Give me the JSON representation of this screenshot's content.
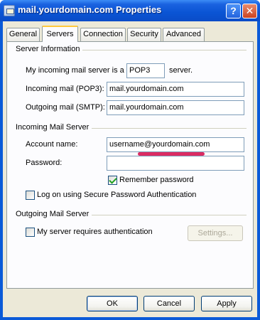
{
  "window": {
    "title": "mail.yourdomain.com Properties",
    "help_glyph": "?",
    "close_glyph": "✕"
  },
  "tabs": [
    {
      "label": "General"
    },
    {
      "label": "Servers"
    },
    {
      "label": "Connection"
    },
    {
      "label": "Security"
    },
    {
      "label": "Advanced"
    }
  ],
  "server_info": {
    "group_label": "Server Information",
    "incoming_type_label": "My incoming mail server is a",
    "incoming_type_value": "POP3",
    "incoming_type_suffix": "server.",
    "incoming_label": "Incoming mail (POP3):",
    "incoming_value": "mail.yourdomain.com",
    "outgoing_label": "Outgoing mail (SMTP):",
    "outgoing_value": "mail.yourdomain.com"
  },
  "incoming_server": {
    "group_label": "Incoming Mail Server",
    "account_label": "Account name:",
    "account_value": "username@yourdomain.com",
    "password_label": "Password:",
    "password_value": "",
    "remember_label": "Remember password",
    "remember_checked": true,
    "spa_label": "Log on using Secure Password Authentication",
    "spa_checked": false
  },
  "outgoing_server": {
    "group_label": "Outgoing Mail Server",
    "auth_label": "My server requires authentication",
    "auth_checked": false,
    "settings_button": "Settings..."
  },
  "buttons": {
    "ok": "OK",
    "cancel": "Cancel",
    "apply": "Apply"
  },
  "colors": {
    "titlebar": "#0a54d4",
    "dialog_face": "#ece9d8",
    "annotation_underline": "#d9205a"
  }
}
